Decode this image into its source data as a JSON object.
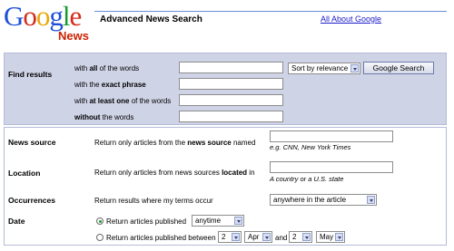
{
  "logo": {
    "g1": "G",
    "o1": "o",
    "o2": "o",
    "g2": "g",
    "l": "l",
    "e": "e",
    "news": "News"
  },
  "header": {
    "title": "Advanced News Search",
    "about_link": "All About Google"
  },
  "find": {
    "section_label": "Find results",
    "all_words": {
      "pre": "with ",
      "bold": "all",
      "post": " of the words",
      "value": ""
    },
    "exact_phrase": {
      "pre": "with the ",
      "bold": "exact phrase",
      "post": "",
      "value": ""
    },
    "at_least_one": {
      "pre": "with ",
      "bold": "at least one",
      "post": " of the words",
      "value": ""
    },
    "without": {
      "pre": "",
      "bold": "without",
      "post": " the words",
      "value": ""
    },
    "sort_selected": "Sort by relevance",
    "search_button": "Google Search"
  },
  "news_source": {
    "label": "News source",
    "desc_pre": "Return only articles from the ",
    "desc_bold": "news source",
    "desc_post": " named",
    "value": "",
    "hint": "e.g. CNN, New York Times"
  },
  "location": {
    "label": "Location",
    "desc_pre": "Return only articles from news sources ",
    "desc_bold": "located",
    "desc_post": " in",
    "value": "",
    "hint": "A country or a U.S. state"
  },
  "occurrences": {
    "label": "Occurrences",
    "desc": "Return results where my terms occur",
    "selected": "anywhere in the article"
  },
  "date": {
    "label": "Date",
    "option1_text": "Return articles published",
    "option1_selected": "anytime",
    "option2_text": "Return articles published between",
    "from_day": "2",
    "from_month": "Apr",
    "and": "and",
    "to_day": "2",
    "to_month": "May"
  },
  "colors": {
    "panel_bg": "#cfd3e6",
    "link": "#1a1acc",
    "radio_selected": "#1a9a2e"
  }
}
